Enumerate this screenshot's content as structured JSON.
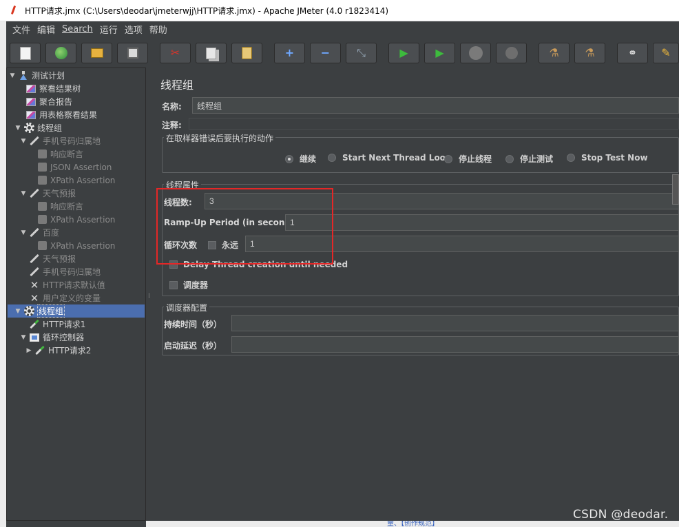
{
  "window": {
    "title": "HTTP请求.jmx (C:\\Users\\deodar\\jmeterwjj\\HTTP请求.jmx) - Apache JMeter (4.0 r1823414)"
  },
  "menu": [
    "文件",
    "编辑",
    "Search",
    "运行",
    "选项",
    "帮助"
  ],
  "toolbar": {
    "buttons": [
      "new-icon",
      "templates-icon",
      "open-icon",
      "save-icon",
      "cut-icon",
      "copy-icon",
      "paste-icon",
      "expand-icon",
      "collapse-icon",
      "toggle-icon",
      "start-icon",
      "start-no-pauses-icon",
      "stop-icon",
      "shutdown-icon",
      "clear-icon",
      "clear-all-icon",
      "search-icon",
      "reset-search-icon"
    ]
  },
  "tree": {
    "test_plan": "测试计划",
    "results_tree": "察看结果树",
    "aggregate_report": "聚合报告",
    "table_results": "用表格察看结果",
    "thread_group_1": "线程组",
    "phone_sampler": "手机号码归属地",
    "response_assertion_1": "响应断言",
    "json_assertion": "JSON Assertion",
    "xpath_assertion_1": "XPath Assertion",
    "weather_sampler": "天气预报",
    "response_assertion_2": "响应断言",
    "xpath_assertion_2": "XPath Assertion",
    "baidu_sampler": "百度",
    "xpath_assertion_3": "XPath Assertion",
    "weather_sampler_2": "天气预报",
    "phone_sampler_2": "手机号码归属地",
    "http_defaults": "HTTP请求默认值",
    "user_vars": "用户定义的变量",
    "thread_group_2": "线程组",
    "http_request_1": "HTTP请求1",
    "loop_controller": "循环控制器",
    "http_request_2": "HTTP请求2"
  },
  "panel": {
    "title": "线程组",
    "name_label": "名称:",
    "name_value": "线程组",
    "comment_label": "注释:",
    "comment_value": "",
    "error_action": {
      "title": "在取样器错误后要执行的动作",
      "options": [
        "继续",
        "Start Next Thread Loop",
        "停止线程",
        "停止测试",
        "Stop Test Now"
      ],
      "selected": "继续"
    },
    "thread_props": {
      "title": "线程属性",
      "threads_label": "线程数:",
      "threads_value": "3",
      "rampup_label": "Ramp-Up Period (in seconds):",
      "rampup_value": "1",
      "loop_label": "循环次数",
      "forever_label": "永远",
      "loop_value": "1",
      "delay_label": "Delay Thread creation until needed",
      "scheduler_label": "调度器"
    },
    "scheduler_config": {
      "title": "调度器配置",
      "duration_label": "持续时间（秒）",
      "duration_value": "",
      "delay_label": "启动延迟（秒）",
      "delay_value": ""
    }
  },
  "footer": {
    "watermark": "CSDN @deodar.",
    "behind_text": "量、【创作规范】"
  },
  "colors": {
    "highlight": "#e52727",
    "selection": "#4b6eaf",
    "background": "#3c3f41"
  }
}
